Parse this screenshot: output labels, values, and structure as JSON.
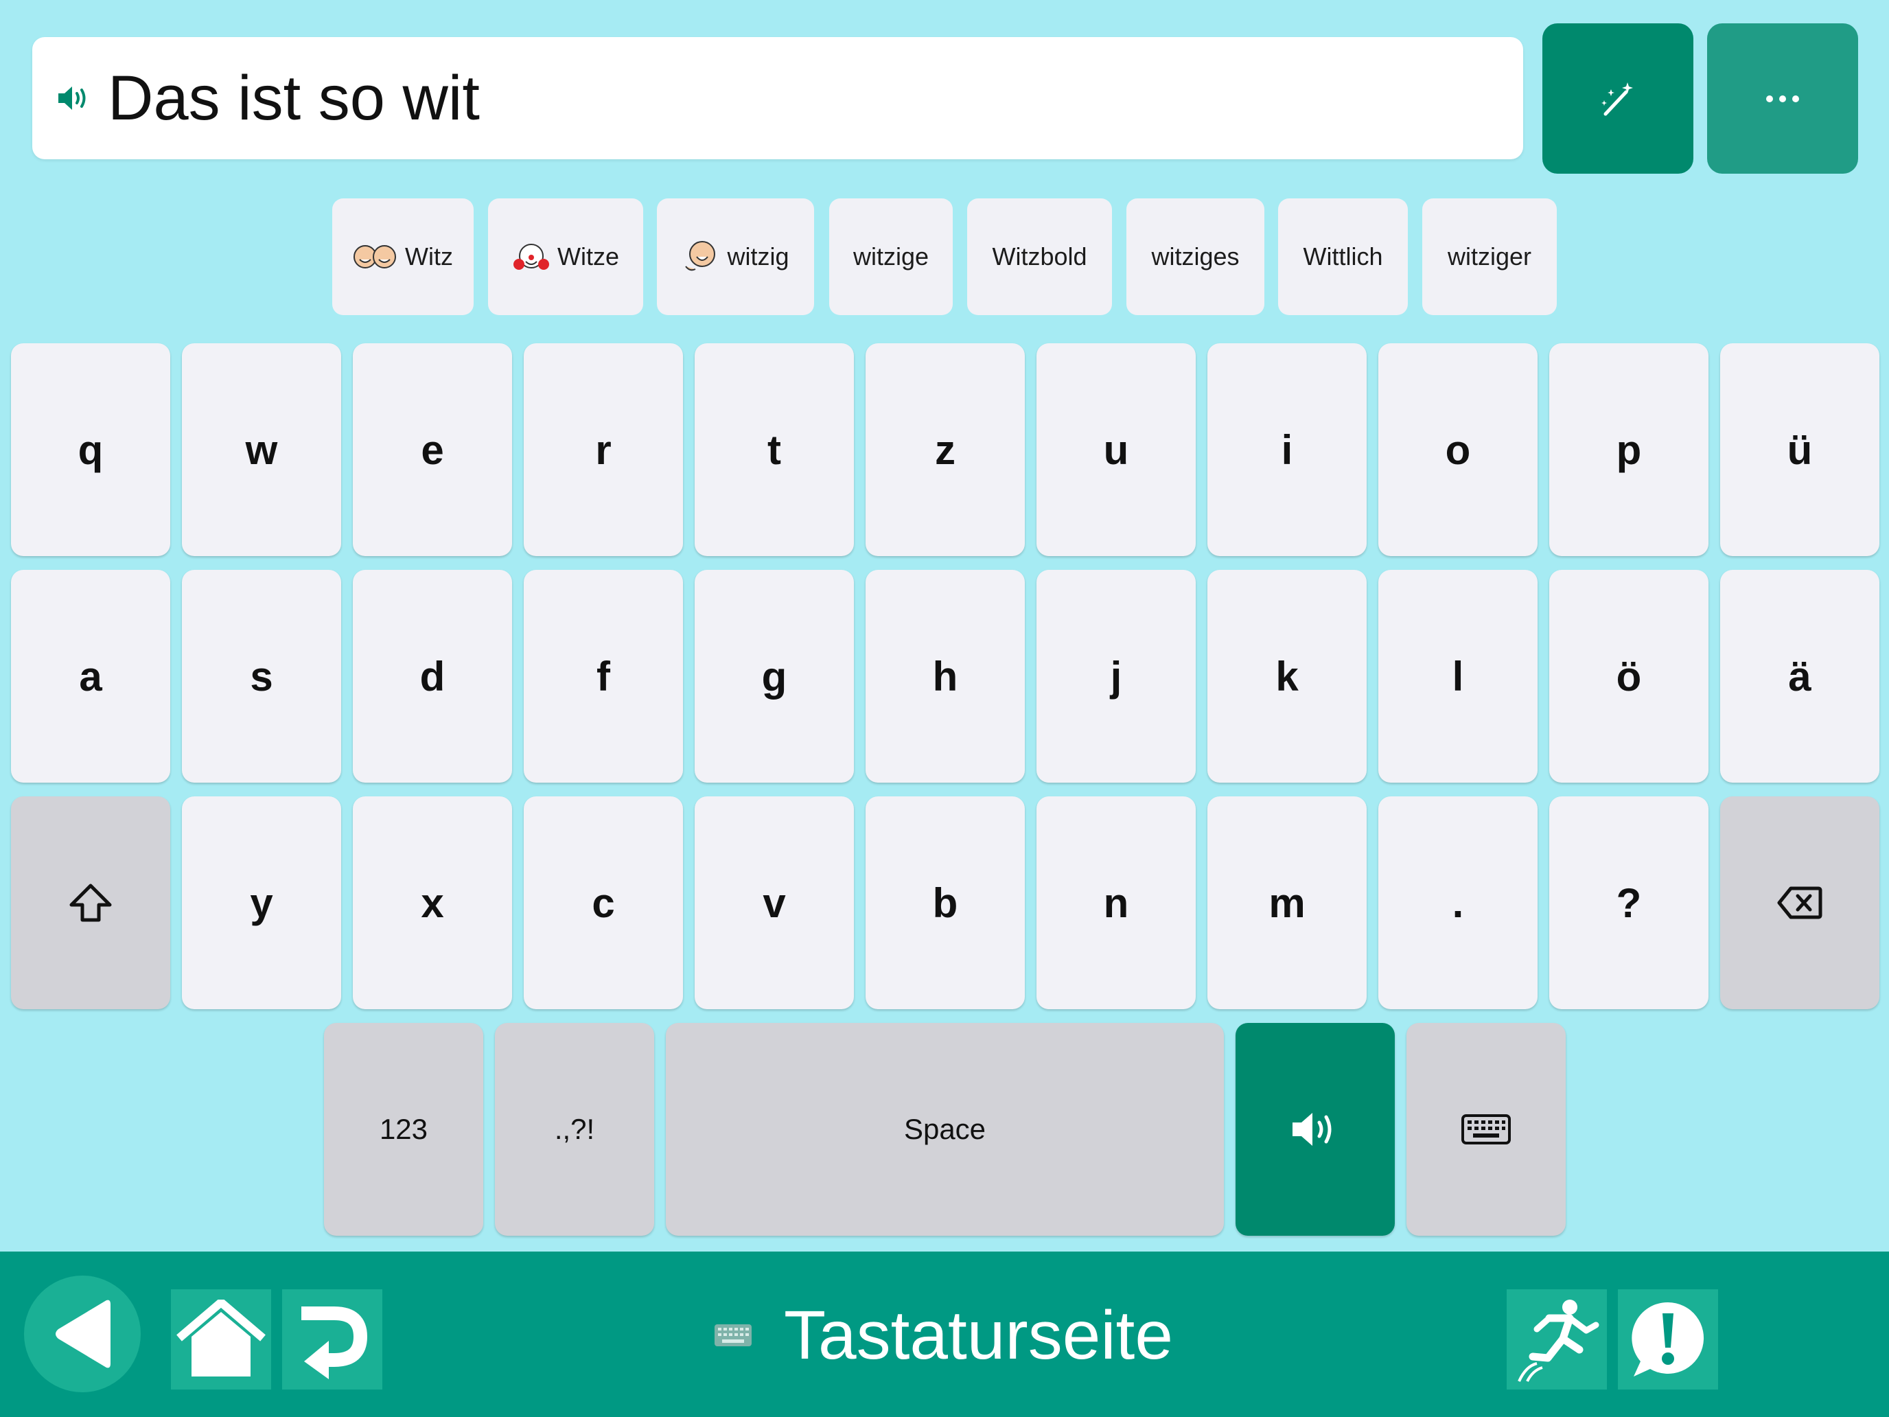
{
  "message": {
    "text": "Das ist so wit"
  },
  "top_buttons": {
    "magic": "magic-wand-icon",
    "more": "more-icon"
  },
  "suggestions": [
    "Witz",
    "Witze",
    "witzig",
    "witzige",
    "Witzbold",
    "witziges",
    "Wittlich",
    "witziger"
  ],
  "keys": {
    "row1": [
      "q",
      "w",
      "e",
      "r",
      "t",
      "z",
      "u",
      "i",
      "o",
      "p",
      "ü"
    ],
    "row2": [
      "a",
      "s",
      "d",
      "f",
      "g",
      "h",
      "j",
      "k",
      "l",
      "ö",
      "ä"
    ],
    "row3": [
      "y",
      "x",
      "c",
      "v",
      "b",
      "n",
      "m",
      ".",
      "?"
    ],
    "numbers": "123",
    "punct": ".,?!",
    "space": "Space"
  },
  "bottom": {
    "title": "Tastaturseite"
  },
  "colors": {
    "background": "#a6ebf3",
    "accent": "#00896d",
    "bar": "#009983"
  }
}
